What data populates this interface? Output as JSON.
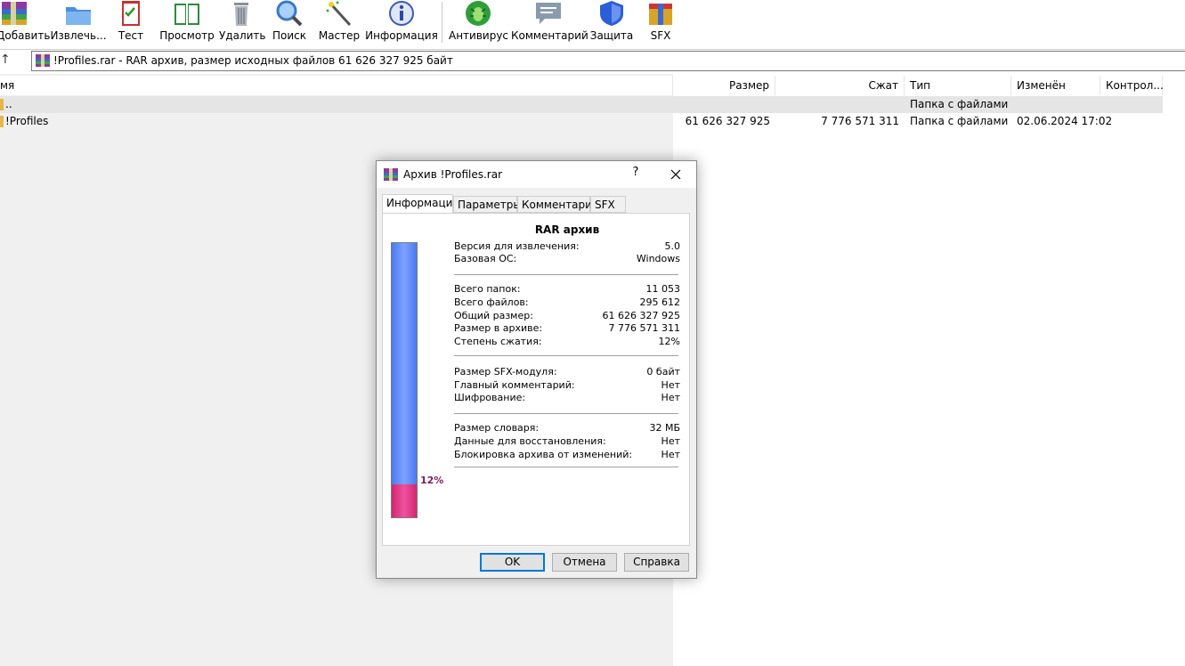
{
  "toolbar": {
    "buttons": [
      {
        "id": "add",
        "label": "Добавить",
        "icon": "archive-add-icon"
      },
      {
        "id": "extract",
        "label": "Извлечь...",
        "icon": "extract-folder-icon"
      },
      {
        "id": "test",
        "label": "Тест",
        "icon": "test-checklist-icon"
      },
      {
        "id": "view",
        "label": "Просмотр",
        "icon": "view-book-icon"
      },
      {
        "id": "delete",
        "label": "Удалить",
        "icon": "trash-bin-icon"
      },
      {
        "id": "find",
        "label": "Поиск",
        "icon": "magnifier-icon"
      },
      {
        "id": "wizard",
        "label": "Мастер",
        "icon": "magic-wand-icon"
      },
      {
        "id": "info",
        "label": "Информация",
        "icon": "info-icon"
      },
      {
        "id": "antivirus",
        "label": "Антивирус",
        "icon": "antivirus-bug-icon"
      },
      {
        "id": "comment",
        "label": "Комментарий",
        "icon": "comment-icon"
      },
      {
        "id": "protect",
        "label": "Защита",
        "icon": "shield-icon"
      },
      {
        "id": "sfx",
        "label": "SFX",
        "icon": "sfx-box-icon"
      }
    ]
  },
  "address": {
    "text": "!Profiles.rar - RAR архив, размер исходных файлов 61 626 327 925 байт"
  },
  "filelist": {
    "columns": {
      "name": "мя",
      "size": "Размер",
      "packed": "Сжат",
      "type": "Тип",
      "modified": "Изменён",
      "crc": "Контрол..."
    },
    "rows": [
      {
        "name": "..",
        "size": "",
        "packed": "",
        "type": "Папка с файлами",
        "modified": "",
        "crc": ""
      },
      {
        "name": "!Profiles",
        "size": "61 626 327 925",
        "packed": "7 776 571 311",
        "type": "Папка с файлами",
        "modified": "02.06.2024 17:02",
        "crc": ""
      }
    ]
  },
  "dialog": {
    "title": "Архив !Profiles.rar",
    "help": "?",
    "tabs": [
      "Информация",
      "Параметры",
      "Комментарий",
      "SFX"
    ],
    "heading": "RAR архив",
    "groups": [
      [
        {
          "k": "Версия для извлечения:",
          "v": "5.0"
        },
        {
          "k": "Базовая ОС:",
          "v": "Windows"
        }
      ],
      [
        {
          "k": "Всего папок:",
          "v": "11 053"
        },
        {
          "k": "Всего файлов:",
          "v": "295 612"
        },
        {
          "k": "Общий размер:",
          "v": "61 626 327 925"
        },
        {
          "k": "Размер в архиве:",
          "v": "7 776 571 311"
        },
        {
          "k": "Степень сжатия:",
          "v": "12%"
        }
      ],
      [
        {
          "k": "Размер SFX-модуля:",
          "v": "0 байт"
        },
        {
          "k": "Главный комментарий:",
          "v": "Нет"
        },
        {
          "k": "Шифрование:",
          "v": "Нет"
        }
      ],
      [
        {
          "k": "Размер словаря:",
          "v": "32 МБ"
        },
        {
          "k": "Данные для восстановления:",
          "v": "Нет"
        },
        {
          "k": "Блокировка архива от изменений:",
          "v": "Нет"
        }
      ]
    ],
    "ratio": 0.12,
    "ratio_label": "12%",
    "buttons": {
      "ok": "OK",
      "cancel": "Отмена",
      "help": "Справка"
    }
  }
}
